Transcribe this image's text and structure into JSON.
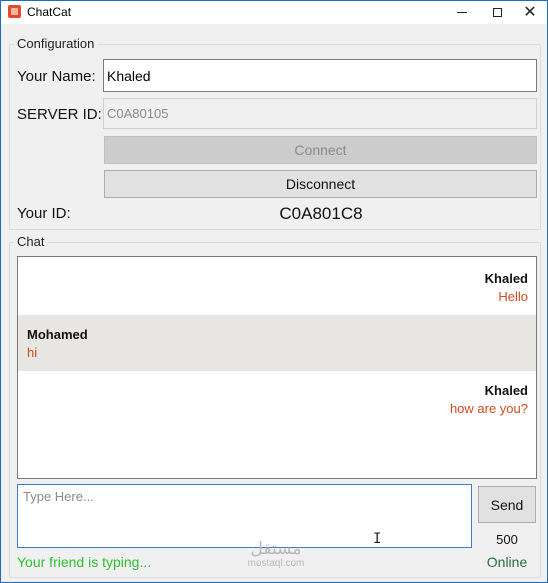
{
  "window": {
    "title": "ChatCat"
  },
  "config": {
    "group_title": "Configuration",
    "name_label": "Your Name:",
    "name_value": "Khaled",
    "server_label": "SERVER ID:",
    "server_value": "C0A80105",
    "connect_label": "Connect",
    "disconnect_label": "Disconnect",
    "your_id_label": "Your ID:",
    "your_id_value": "C0A801C8"
  },
  "chat": {
    "group_title": "Chat",
    "messages": [
      {
        "sender": "Khaled",
        "text": "Hello",
        "align": "right"
      },
      {
        "sender": "Mohamed",
        "text": "hi",
        "align": "left"
      },
      {
        "sender": "Khaled",
        "text": "how are you?",
        "align": "right"
      }
    ],
    "input_placeholder": "Type Here...",
    "send_label": "Send",
    "char_count": "500",
    "typing_status": "Your friend is typing...",
    "online_status": "Online",
    "accent_color": "#d04a1e",
    "typing_color": "#2fbf2f"
  },
  "watermark": {
    "arabic": "مستقل",
    "latin": "mostaql.com"
  }
}
